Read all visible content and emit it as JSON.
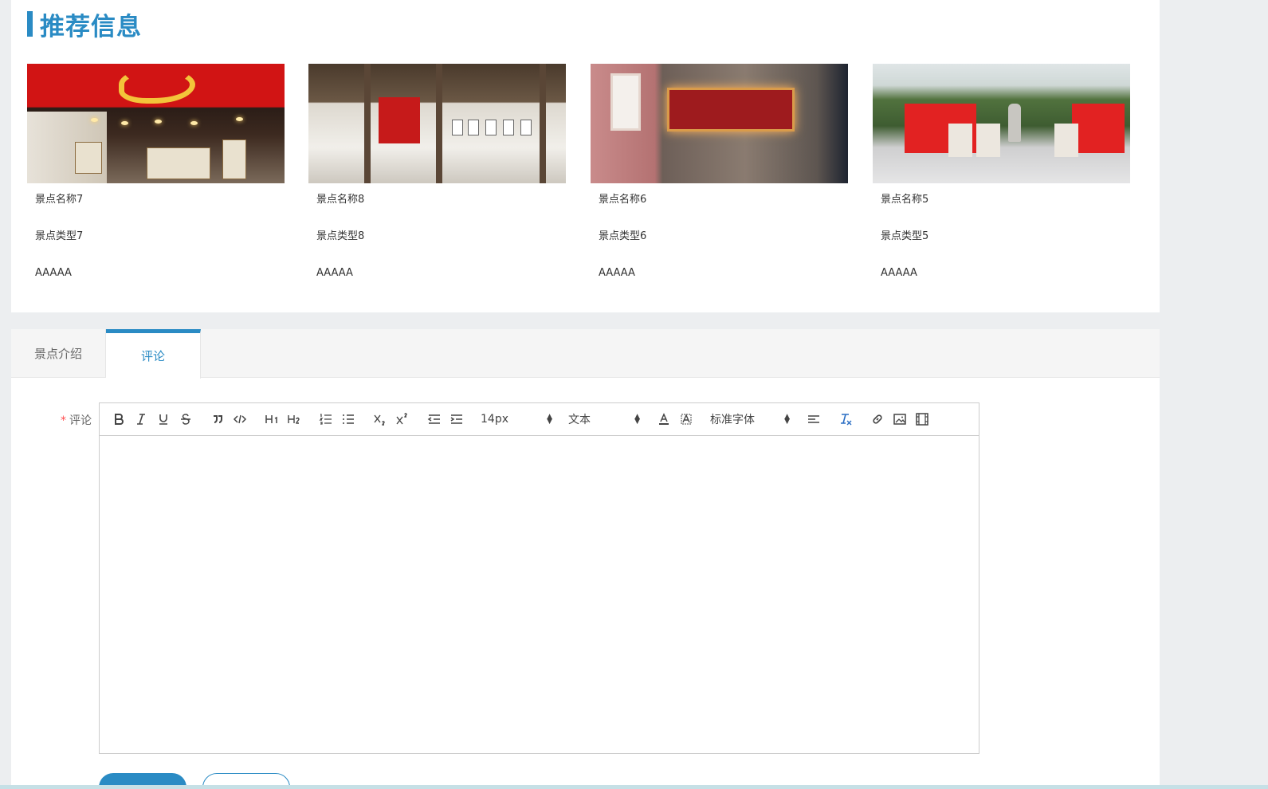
{
  "recommend": {
    "title": "推荐信息",
    "items": [
      {
        "name": "景点名称7",
        "type": "景点类型7",
        "level": "AAAAA",
        "image": "exhibition-hall-red-ceiling"
      },
      {
        "name": "景点名称8",
        "type": "景点类型8",
        "level": "AAAAA",
        "image": "wooden-hall-exhibition"
      },
      {
        "name": "景点名称6",
        "type": "景点类型6",
        "level": "AAAAA",
        "image": "brick-wall-plaque"
      },
      {
        "name": "景点名称5",
        "type": "景点类型5",
        "level": "AAAAA",
        "image": "outdoor-memorial-square"
      }
    ]
  },
  "tabs": [
    {
      "label": "景点介绍",
      "active": false
    },
    {
      "label": "评论",
      "active": true
    }
  ],
  "comment_form": {
    "label": "评论",
    "required_mark": "*",
    "toolbar": {
      "font_size": "14px",
      "header_picker": "文本",
      "font_family": "标准字体",
      "icons": [
        "bold-icon",
        "italic-icon",
        "underline-icon",
        "strike-icon",
        "blockquote-icon",
        "code-icon",
        "h1-icon",
        "h2-icon",
        "ordered-list-icon",
        "bullet-list-icon",
        "subscript-icon",
        "superscript-icon",
        "outdent-icon",
        "indent-icon",
        "font-color-icon",
        "background-color-icon",
        "align-icon",
        "clean-format-icon",
        "link-icon",
        "image-icon",
        "video-icon"
      ]
    },
    "content": ""
  },
  "colors": {
    "accent": "#2a8bc4",
    "background": "#eceef0",
    "required": "#ff4d4f"
  }
}
